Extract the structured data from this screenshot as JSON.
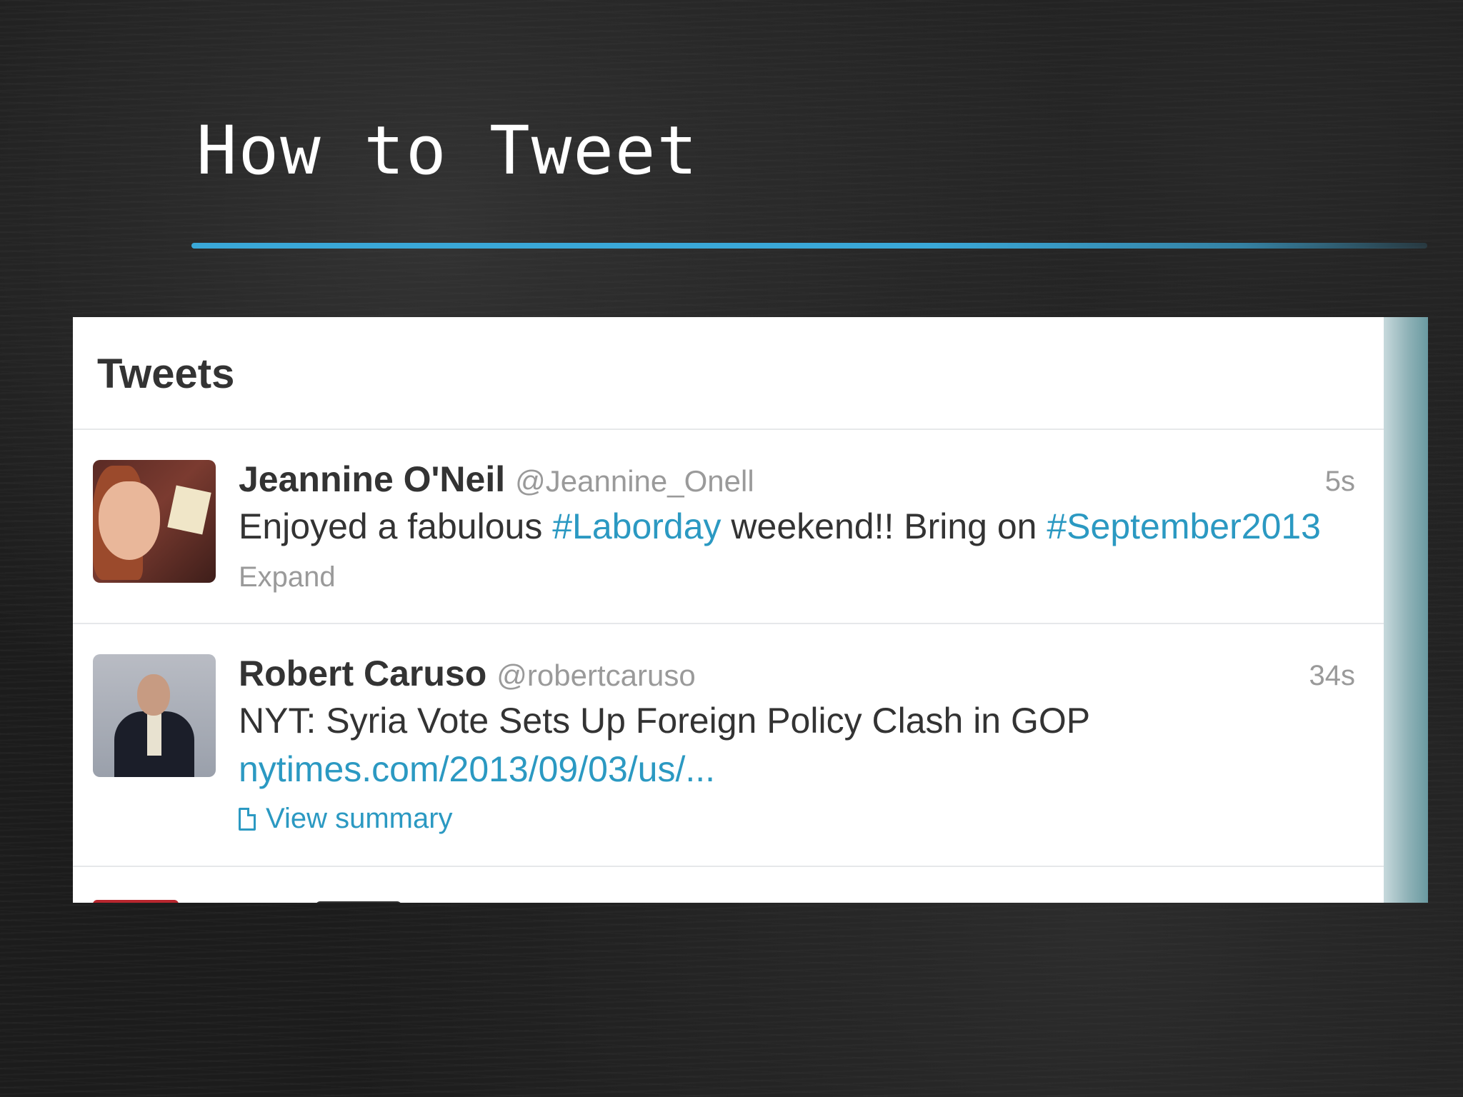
{
  "slide": {
    "title": "How to Tweet",
    "accent_color": "#3aa8d8"
  },
  "panel": {
    "header": "Tweets",
    "link_color": "#2b99c2",
    "tweets": [
      {
        "avatar": "avatar-photo-woman",
        "name": "Jeannine O'Neil",
        "handle": "@Jeannine_Onell",
        "time": "5s",
        "text_before": "Enjoyed a fabulous ",
        "hashtag_1": "#Laborday",
        "text_middle": " weekend!! Bring on ",
        "hashtag_2": "#September2013",
        "action": "Expand"
      },
      {
        "avatar": "avatar-photo-man",
        "name": "Robert Caruso",
        "handle": "@robertcaruso",
        "time": "34s",
        "text": "NYT: Syria Vote Sets Up Foreign Policy Clash in GOP",
        "link": "nytimes.com/2013/09/03/us/...",
        "action_icon": "document-icon",
        "action": "View summary"
      }
    ]
  }
}
